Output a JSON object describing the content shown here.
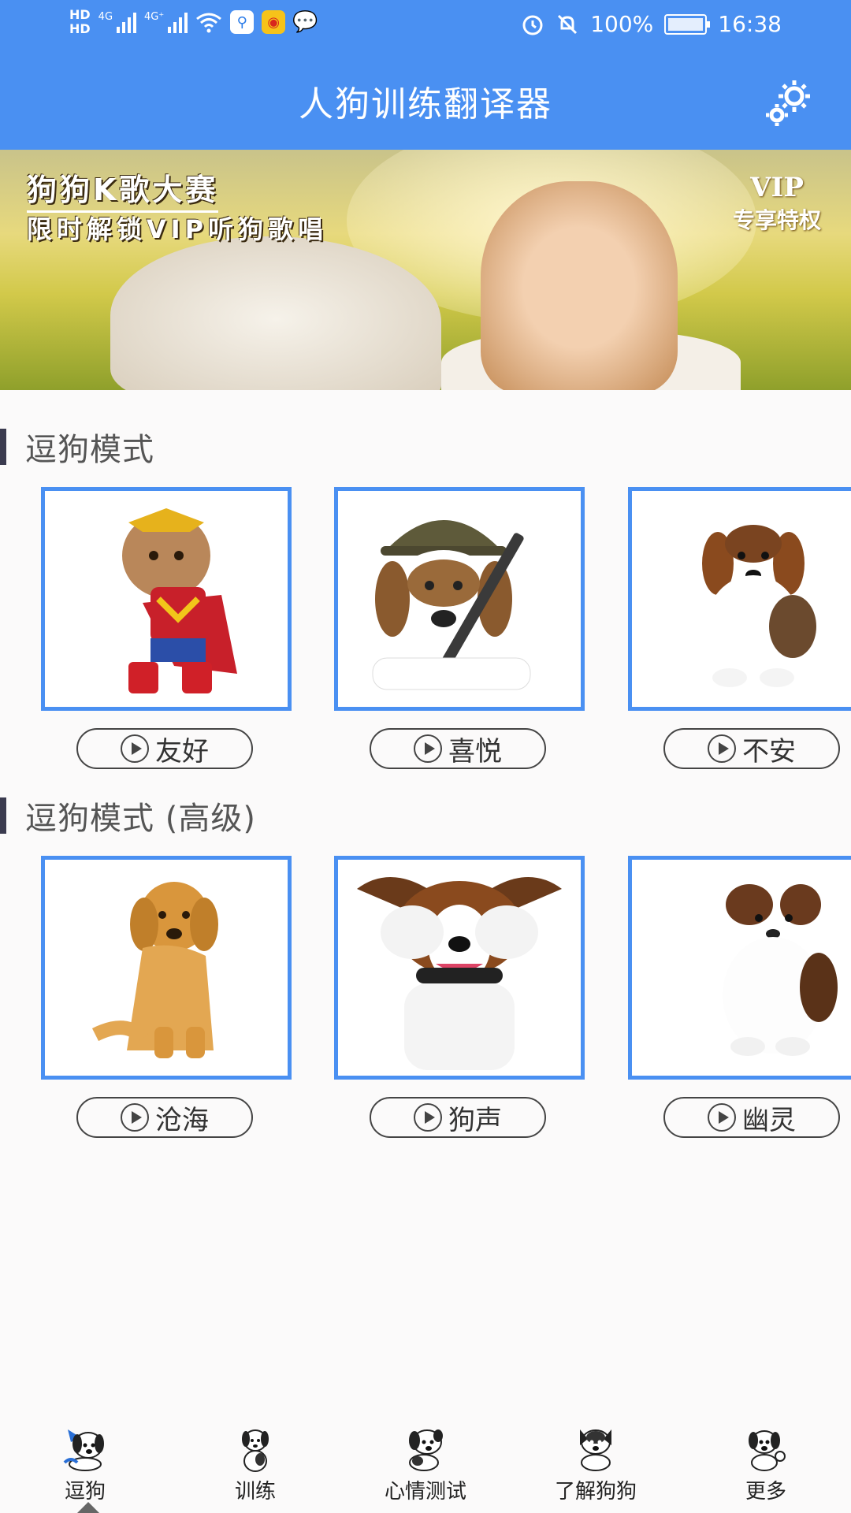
{
  "status_bar": {
    "hd1": "HD",
    "hd2": "HD",
    "net1": "4G",
    "net2": "4G⁺",
    "battery_percent": "100%",
    "time": "16:38"
  },
  "header": {
    "title": "人狗训练翻译器",
    "settings_icon": "gear-icon"
  },
  "banner": {
    "line1": "狗狗K歌大赛",
    "line2": "限时解锁VIP听狗歌唱",
    "vip": "VIP",
    "vip_sub": "专享特权"
  },
  "section1": {
    "title": "逗狗模式",
    "items": [
      {
        "label": "友好",
        "image": "dog-in-superhero-costume"
      },
      {
        "label": "喜悦",
        "image": "beagle-with-helmet-and-rifle"
      },
      {
        "label": "不安",
        "image": "sitting-beagle-puppy"
      }
    ]
  },
  "section2": {
    "title": "逗狗模式 (高级)",
    "items": [
      {
        "label": "沧海",
        "image": "golden-retriever"
      },
      {
        "label": "狗声",
        "image": "dog-covering-eyes"
      },
      {
        "label": "幽灵",
        "image": "fluffy-puppy"
      }
    ]
  },
  "tabbar": {
    "items": [
      {
        "label": "逗狗",
        "icon": "dog-play-icon",
        "active": true
      },
      {
        "label": "训练",
        "icon": "dog-training-icon"
      },
      {
        "label": "心情测试",
        "icon": "dog-mood-icon"
      },
      {
        "label": "了解狗狗",
        "icon": "dog-info-icon"
      },
      {
        "label": "更多",
        "icon": "dog-more-icon"
      }
    ]
  },
  "colors": {
    "primary": "#4a90f2",
    "background": "#fbfafa",
    "section_bar": "#3b3b4f"
  }
}
